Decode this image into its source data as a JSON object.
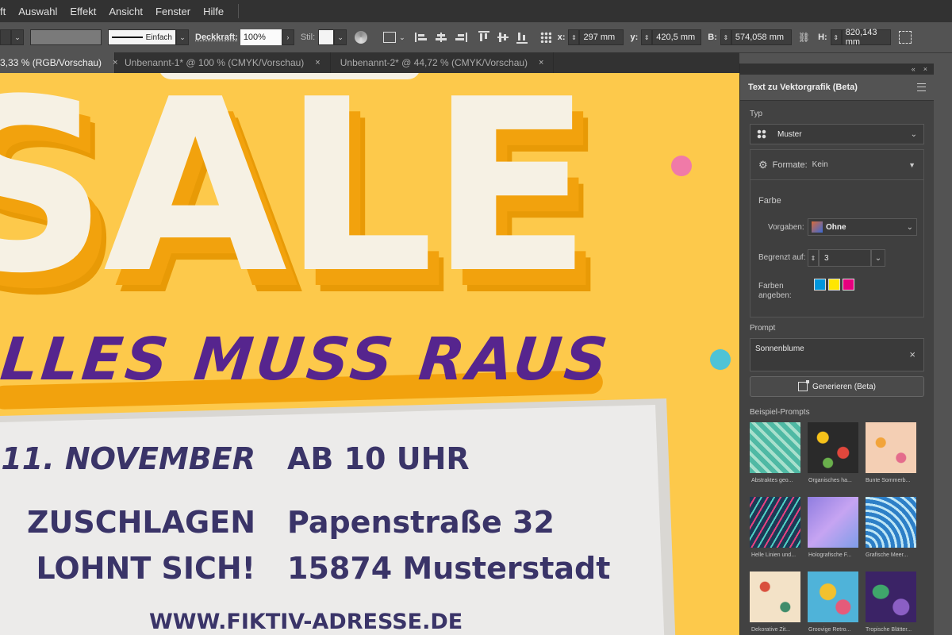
{
  "menubar": {
    "items": [
      "ft",
      "Auswahl",
      "Effekt",
      "Ansicht",
      "Fenster",
      "Hilfe"
    ]
  },
  "control_bar": {
    "stroke_style": "Einfach",
    "opacity_label": "Deckkraft:",
    "opacity_value": "100%",
    "style_label": "Stil:",
    "x_label": "x:",
    "x_value": "297 mm",
    "y_label": "y:",
    "y_value": "420,5 mm",
    "w_label": "B:",
    "w_value": "574,058 mm",
    "h_label": "H:",
    "h_value": "820,143 mm"
  },
  "tabs": [
    {
      "label": "3,33 % (RGB/Vorschau)",
      "close": "×"
    },
    {
      "label": "Unbenannt-1* @ 100 % (CMYK/Vorschau)",
      "close": "×"
    },
    {
      "label": "Unbenannt-2* @ 44,72 % (CMYK/Vorschau)",
      "close": "×"
    }
  ],
  "poster": {
    "sale": "SALE",
    "headline": "ALLES MUSS RAUS",
    "date": "11. NOVEMBER",
    "time": "AB 10 UHR",
    "slogan1": "ZUSCHLAGEN",
    "slogan2": "LOHNT SICH!",
    "street": "Papenstraße 32",
    "city": "15874 Musterstadt",
    "web": "WWW.FIKTIV-ADRESSE.DE"
  },
  "panel": {
    "collapse_icon": "«",
    "close_icon": "×",
    "title": "Text zu Vektorgrafik (Beta)",
    "typ_label": "Typ",
    "typ_value": "Muster",
    "formate_label": "Formate:",
    "formate_value": "Kein",
    "farbe_label": "Farbe",
    "vorgaben_label": "Vorgaben:",
    "vorgaben_value": "Ohne",
    "begrenzt_label": "Begrenzt auf:",
    "begrenzt_value": "3",
    "farben_label1": "Farben",
    "farben_label2": "angeben:",
    "prompt_label": "Prompt",
    "prompt_value": "Sonnenblume",
    "generate_label": "Generieren (Beta)",
    "examples_label": "Beispiel-Prompts",
    "examples": [
      "Abstraktes geo...",
      "Organisches ha...",
      "Bunte Sommerb...",
      "Helle Linien und...",
      "Holografische F...",
      "Grafische Meer...",
      "Dekorative Zit...",
      "Groovige Retro...",
      "Tropische Blätter..."
    ]
  },
  "colors": {
    "poster_bg": "#fdc94b",
    "sale_fill": "#f6f1e4",
    "sale_shadow": "#f2a20d",
    "headline": "#56258e",
    "paper": "#ecebea",
    "info_text": "#3a3468",
    "swatch_cyan": "#0096dc",
    "swatch_yellow": "#ffe600",
    "swatch_magenta": "#e6007e"
  }
}
